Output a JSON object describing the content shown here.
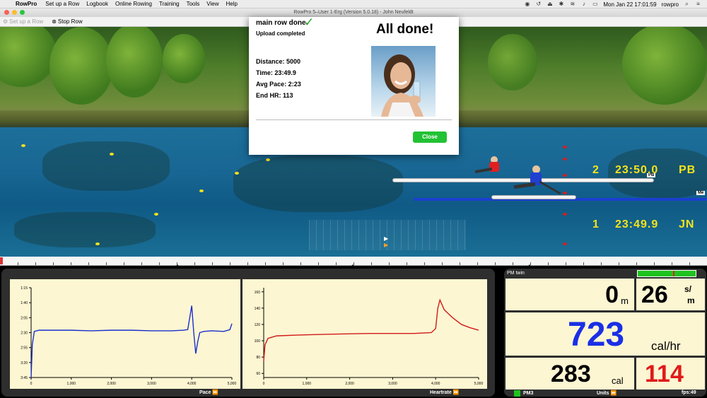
{
  "menubar": {
    "app": "RowPro",
    "items": [
      "Set up a Row",
      "Logbook",
      "Online Rowing",
      "Training",
      "Tools",
      "View",
      "Help"
    ],
    "clock": "Mon Jan 22  17:01:59",
    "user": "rowpro"
  },
  "window": {
    "title": "RowPro 5–User 1-Erg (Version 5.0.18) - John Neufeldt"
  },
  "toolbar": {
    "setup_label": "Set up a Row",
    "stop_label": "Stop Row"
  },
  "race": {
    "lanes": [
      {
        "place": "2",
        "time": "23:50.0",
        "name": "PB",
        "tag": "PB"
      },
      {
        "place": "1",
        "time": "23:49.9",
        "name": "JN",
        "tag": "Me"
      }
    ]
  },
  "dialog": {
    "title": "main row done",
    "status": "Upload completed",
    "heading": "All done!",
    "distance": "Distance: 5000",
    "time": "Time: 23:49.9",
    "avg_pace": "Avg Pace: 2:23",
    "end_hr": "End HR: 113",
    "close_label": "Close"
  },
  "charts": {
    "pace_label": "Pace",
    "hr_label": "Heartrate"
  },
  "chart_data": [
    {
      "type": "line",
      "title": "",
      "xlabel": "",
      "ylabel": "",
      "x_ticks": [
        "0",
        "1,000",
        "2,000",
        "3,000",
        "4,000",
        "5,000"
      ],
      "y_ticks": [
        "1:15",
        "1:40",
        "2:05",
        "2:30",
        "2:55",
        "3:20",
        "3:45"
      ],
      "xlim": [
        0,
        5000
      ],
      "ylim_seconds": [
        75,
        225
      ],
      "series": [
        {
          "color": "#1a2fd0",
          "x": [
            0,
            30,
            80,
            200,
            500,
            1000,
            1500,
            2000,
            2500,
            3000,
            3500,
            3800,
            3900,
            3950,
            4000,
            4050,
            4100,
            4150,
            4200,
            4300,
            4500,
            4800,
            4950,
            5000
          ],
          "y": [
            225,
            170,
            148,
            146,
            146,
            146,
            147,
            146,
            146,
            147,
            147,
            146,
            145,
            125,
            105,
            150,
            185,
            165,
            150,
            148,
            147,
            148,
            145,
            135
          ]
        }
      ]
    },
    {
      "type": "line",
      "title": "",
      "xlabel": "",
      "ylabel": "",
      "x_ticks": [
        "0",
        "1,000",
        "2,000",
        "3,000",
        "4,000",
        "5,000"
      ],
      "y_ticks": [
        "60",
        "80",
        "100",
        "120",
        "140",
        "160"
      ],
      "xlim": [
        0,
        5000
      ],
      "ylim": [
        55,
        165
      ],
      "series": [
        {
          "color": "#d01a1a",
          "x": [
            0,
            30,
            100,
            300,
            800,
            1500,
            2500,
            3500,
            3900,
            4000,
            4050,
            4100,
            4200,
            4400,
            4600,
            4800,
            5000
          ],
          "y": [
            75,
            95,
            103,
            106,
            107,
            108,
            109,
            109,
            110,
            115,
            140,
            150,
            138,
            128,
            120,
            116,
            113
          ]
        }
      ]
    }
  ],
  "monitor": {
    "header": "PM twin",
    "distance": "0",
    "distance_unit": "m",
    "spm": "26",
    "spm_unit_top": "s/",
    "spm_unit_bottom": "m",
    "calhr": "723",
    "calhr_unit": "cal/hr",
    "cal": "283",
    "cal_unit": "cal",
    "hr": "114",
    "pm_label": "PM3",
    "units_label": "Units",
    "fps": "fps:49",
    "colors": {
      "calhr": "#1a2fe6",
      "hr": "#e01a1a"
    }
  }
}
